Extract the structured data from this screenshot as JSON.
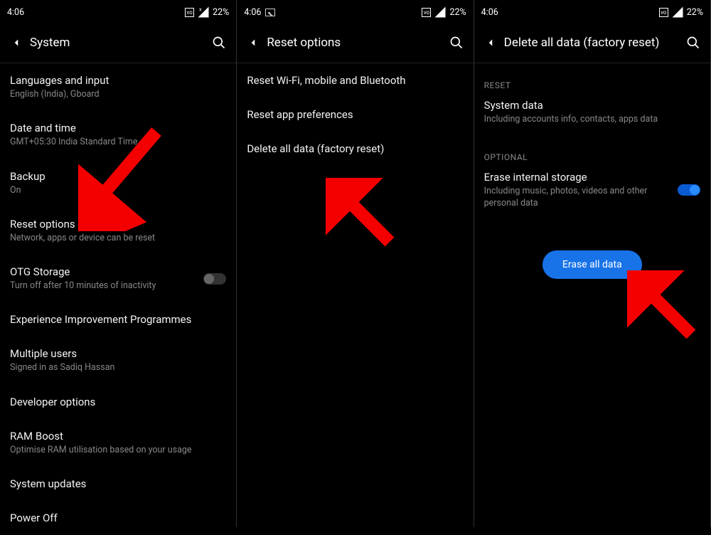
{
  "status": {
    "time": "4:06",
    "battery": "22%"
  },
  "panel1": {
    "title": "System",
    "items": [
      {
        "title": "Languages and input",
        "sub": "English (India), Gboard"
      },
      {
        "title": "Date and time",
        "sub": "GMT+05:30 India Standard Time"
      },
      {
        "title": "Backup",
        "sub": "On"
      },
      {
        "title": "Reset options",
        "sub": "Network, apps or device can be reset"
      },
      {
        "title": "OTG Storage",
        "sub": "Turn off after 10 minutes of inactivity"
      },
      {
        "title": "Experience Improvement Programmes"
      },
      {
        "title": "Multiple users",
        "sub": "Signed in as Sadiq Hassan"
      },
      {
        "title": "Developer options"
      },
      {
        "title": "RAM Boost",
        "sub": "Optimise RAM utilisation based on your usage"
      },
      {
        "title": "System updates"
      },
      {
        "title": "Power Off"
      }
    ]
  },
  "panel2": {
    "title": "Reset options",
    "items": [
      {
        "title": "Reset Wi-Fi, mobile and Bluetooth"
      },
      {
        "title": "Reset app preferences"
      },
      {
        "title": "Delete all data (factory reset)"
      }
    ]
  },
  "panel3": {
    "title": "Delete all data (factory reset)",
    "section_reset": "RESET",
    "system_data": {
      "title": "System data",
      "sub": "Including accounts info, contacts, apps data"
    },
    "section_optional": "OPTIONAL",
    "erase_storage": {
      "title": "Erase internal storage",
      "sub": "Including music, photos, videos and other personal data"
    },
    "button": "Erase all data"
  }
}
